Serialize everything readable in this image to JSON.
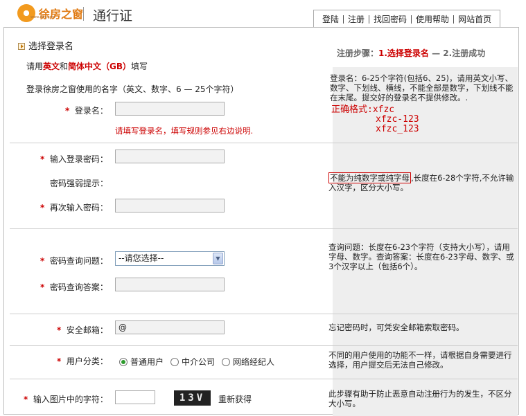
{
  "header": {
    "logo_text": "徐房之窗",
    "logo_sub": "www.xfzc.com",
    "site_title": "通行证",
    "nav": [
      "登陆",
      "注册",
      "找回密码",
      "使用帮助",
      "网站首页"
    ]
  },
  "intro": {
    "section_title": "选择登录名",
    "fill_prefix": "请用",
    "fill_en": "英文",
    "fill_and": "和",
    "fill_cn": "简体中文（GB）",
    "fill_suffix": "填写",
    "steps_label": "注册步骤：",
    "step1": "1.选择登录名",
    "step_dash": " — ",
    "step2": "2.注册成功"
  },
  "username": {
    "desc": "登录徐房之窗使用的名字（英文、数字、6 — 25个字符）",
    "star": "*",
    "label": "登录名：",
    "value": "",
    "error": "请填写登录名，填写规则参见右边说明.",
    "note": "登录名：6-25个字符(包括6、25)，请用英文小写、数字、下划线、横线，不能全部是数字，下划线不能在末尾。提交好的登录名不提供修改。.",
    "example_label": "正确格式:",
    "examples": [
      "xfzc",
      "xfzc-123",
      "xfzc_123"
    ]
  },
  "password": {
    "star": "*",
    "label": "输入登录密码：",
    "strength_label": "密码强弱提示：",
    "confirm_label": "再次输入密码：",
    "note_highlight": "不能为纯数字或纯字母",
    "note_rest": ",长度在6-28个字符,不允许输入汉字，区分大小写。"
  },
  "security": {
    "star": "*",
    "question_label": "密码查询问题：",
    "question_selected": "--请您选择--",
    "answer_label": "密码查询答案：",
    "note": "查询问题：长度在6-23个字符（支持大小写），请用字母、数字。查询答案：长度在6-23字母、数字、或3个汉字以上（包括6个）。"
  },
  "email": {
    "star": "*",
    "label": "安全邮箱：",
    "value": "@",
    "note": "忘记密码时，可凭安全邮箱索取密码。"
  },
  "usertype": {
    "star": "*",
    "label": "用户分类：",
    "options": [
      "普通用户",
      "中介公司",
      "网络经纪人"
    ],
    "note": "不同的用户使用的功能不一样，请根据自身需要进行选择，用户提交后无法自己修改。"
  },
  "captcha": {
    "star": "*",
    "label": "输入图片中的字符：",
    "image_text": "13V",
    "refresh": "重新获得",
    "note": "此步骤有助于防止恶意自动注册行为的发生，不区分大小写。"
  },
  "colors": {
    "accent": "#cc0000",
    "brand": "#e07a12",
    "panel": "#eeeeee"
  }
}
